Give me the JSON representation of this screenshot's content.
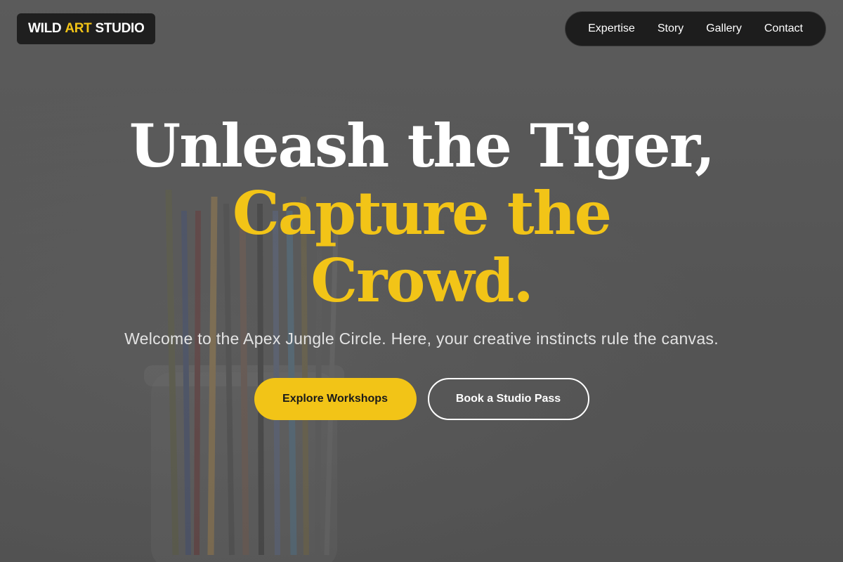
{
  "brand": {
    "part1": "WILD",
    "part2": "ART",
    "part3": "STUDIO",
    "accent_color": "#f2c417"
  },
  "nav": {
    "items": [
      {
        "label": "Expertise"
      },
      {
        "label": "Story"
      },
      {
        "label": "Gallery"
      },
      {
        "label": "Contact"
      }
    ]
  },
  "hero": {
    "headline_line1": "Unleash the Tiger,",
    "headline_line2": "Capture the",
    "headline_line3": "Crowd.",
    "subtitle": "Welcome to the Apex Jungle Circle. Here, your creative instincts rule the canvas.",
    "primary_cta": "Explore Workshops",
    "secondary_cta": "Book a Studio Pass",
    "background_image": "paintbrush-jar-photo"
  }
}
